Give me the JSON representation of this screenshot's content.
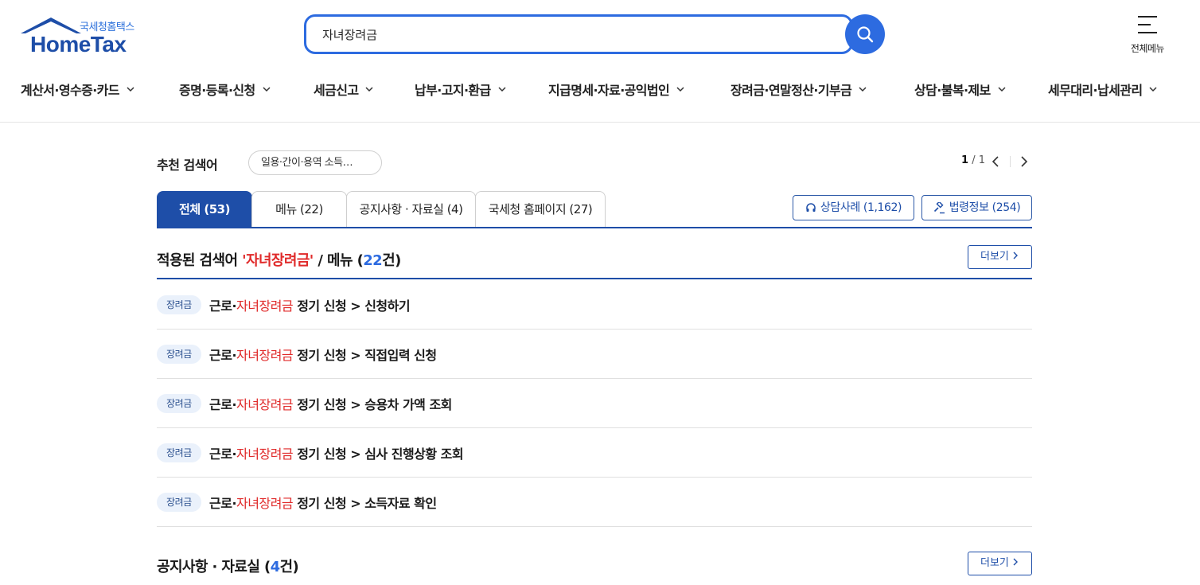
{
  "header": {
    "logo_sub": "국세청홈택스",
    "logo_main": "HomeTax",
    "search_value": "자녀장려금",
    "menu_all_label": "전체메뉴"
  },
  "gnb": [
    {
      "label": "계산서·영수증·카드"
    },
    {
      "label": "증명·등록·신청"
    },
    {
      "label": "세금신고"
    },
    {
      "label": "납부·고지·환급"
    },
    {
      "label": "지급명세·자료·공익법인"
    },
    {
      "label": "장려금·연말정산·기부금"
    },
    {
      "label": "상담·불복·제보"
    },
    {
      "label": "세무대리·납세관리"
    }
  ],
  "recommend": {
    "label": "추천 검색어",
    "chip": "일용·간이·용역 소득…",
    "page_current": "1",
    "page_total": "/ 1"
  },
  "tabs": [
    {
      "label": "전체 (53)",
      "active": true
    },
    {
      "label": "메뉴 (22)"
    },
    {
      "label": "공지사항 · 자료실 (4)"
    },
    {
      "label": "국세청 홈페이지 (27)"
    }
  ],
  "ext_buttons": {
    "consult": "상담사례 (1,162)",
    "law": "법령정보 (254)"
  },
  "menu_section": {
    "title_prefix": "적용된 검색어 ",
    "keyword": "'자녀장려금'",
    "title_mid": " / 메뉴 (",
    "count": "22",
    "title_suffix": "건)",
    "more": "더보기"
  },
  "results": [
    {
      "badge": "장려금",
      "pre": "근로·",
      "hl": "자녀장려금",
      "post": " 정기 신청 > 신청하기"
    },
    {
      "badge": "장려금",
      "pre": "근로·",
      "hl": "자녀장려금",
      "post": " 정기 신청 > 직접입력 신청"
    },
    {
      "badge": "장려금",
      "pre": "근로·",
      "hl": "자녀장려금",
      "post": " 정기 신청 > 승용차 가액 조회"
    },
    {
      "badge": "장려금",
      "pre": "근로·",
      "hl": "자녀장려금",
      "post": " 정기 신청 > 심사 진행상황 조회"
    },
    {
      "badge": "장려금",
      "pre": "근로·",
      "hl": "자녀장려금",
      "post": " 정기 신청 > 소득자료 확인"
    }
  ],
  "notice_section": {
    "title_prefix": "공지사항 · 자료실 (",
    "count": "4",
    "title_suffix": "건)",
    "more": "더보기"
  },
  "colors": {
    "brand": "#1e4ea8",
    "accent": "#2d6be0",
    "highlight": "#e02a2a"
  }
}
